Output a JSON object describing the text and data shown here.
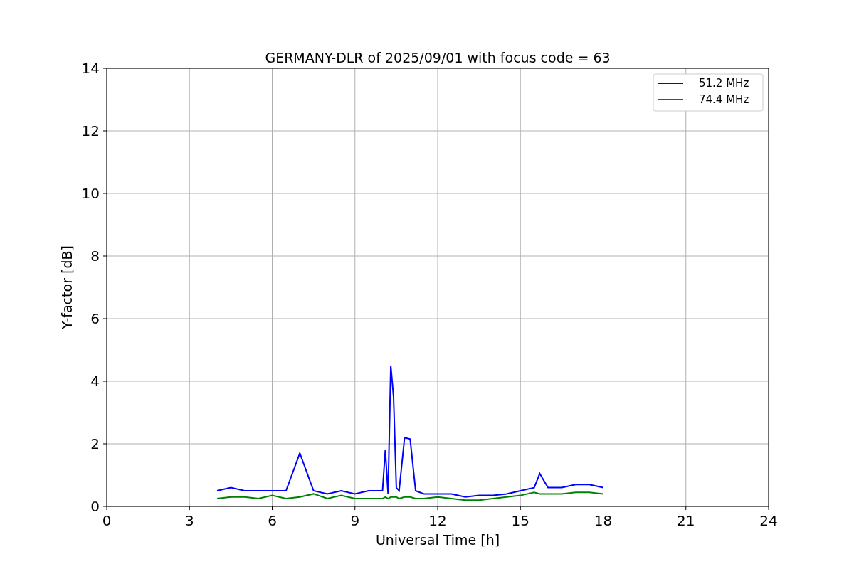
{
  "chart_data": {
    "type": "line",
    "title": "GERMANY-DLR of 2025/09/01 with focus code = 63",
    "xlabel": "Universal Time [h]",
    "ylabel": "Y-factor [dB]",
    "x": [
      4,
      4.5,
      5,
      5.5,
      6,
      6.5,
      7,
      7.5,
      8,
      8.5,
      9,
      9.5,
      10,
      10.1,
      10.2,
      10.3,
      10.4,
      10.5,
      10.6,
      10.8,
      11,
      11.2,
      11.5,
      12,
      12.5,
      13,
      13.5,
      14,
      14.5,
      15,
      15.5,
      15.7,
      16,
      16.5,
      17,
      17.5,
      18
    ],
    "series": [
      {
        "name": "51.2 MHz",
        "color": "#0000ff",
        "values": [
          0.5,
          0.6,
          0.5,
          0.5,
          0.5,
          0.5,
          1.7,
          0.5,
          0.4,
          0.5,
          0.4,
          0.5,
          0.5,
          1.8,
          0.4,
          4.5,
          3.5,
          0.6,
          0.5,
          2.2,
          2.15,
          0.5,
          0.4,
          0.4,
          0.4,
          0.3,
          0.35,
          0.35,
          0.4,
          0.5,
          0.6,
          1.05,
          0.6,
          0.6,
          0.7,
          0.7,
          0.6
        ]
      },
      {
        "name": "74.4 MHz",
        "color": "#008000",
        "values": [
          0.25,
          0.3,
          0.3,
          0.25,
          0.35,
          0.25,
          0.3,
          0.4,
          0.25,
          0.35,
          0.25,
          0.25,
          0.25,
          0.3,
          0.25,
          0.3,
          0.3,
          0.3,
          0.25,
          0.3,
          0.3,
          0.25,
          0.25,
          0.3,
          0.25,
          0.2,
          0.2,
          0.25,
          0.3,
          0.35,
          0.45,
          0.4,
          0.4,
          0.4,
          0.45,
          0.45,
          0.4
        ]
      }
    ],
    "xlim": [
      0,
      24
    ],
    "ylim": [
      0,
      14
    ],
    "xticks": [
      0,
      3,
      6,
      9,
      12,
      15,
      18,
      21,
      24
    ],
    "yticks": [
      0,
      2,
      4,
      6,
      8,
      10,
      12,
      14
    ],
    "grid": true,
    "legend": true
  }
}
